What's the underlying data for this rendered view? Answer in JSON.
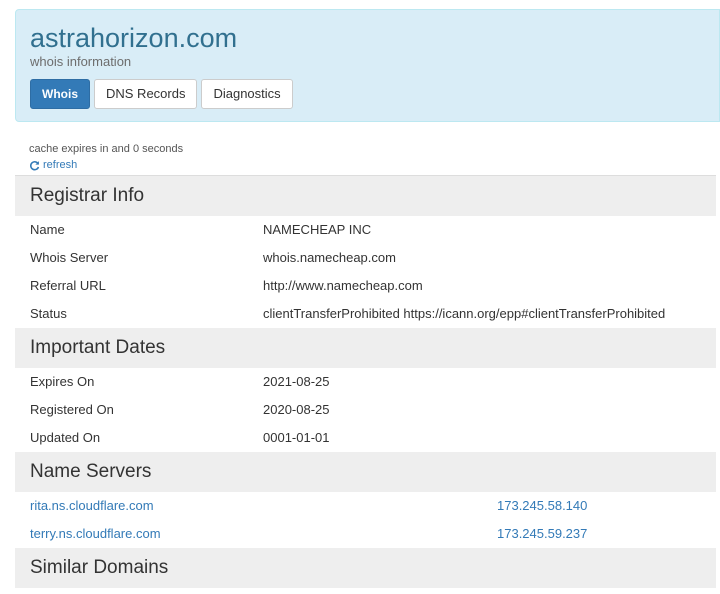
{
  "header": {
    "domain": "astrahorizon.com",
    "subtitle": "whois information",
    "tabs": [
      {
        "label": "Whois",
        "active": true
      },
      {
        "label": "DNS Records",
        "active": false
      },
      {
        "label": "Diagnostics",
        "active": false
      }
    ]
  },
  "cache": {
    "text": "cache expires in and 0 seconds",
    "refresh_label": "refresh",
    "refresh_icon": "refresh-icon"
  },
  "registrar": {
    "title": "Registrar Info",
    "rows": [
      {
        "label": "Name",
        "value": "NAMECHEAP INC"
      },
      {
        "label": "Whois Server",
        "value": "whois.namecheap.com"
      },
      {
        "label": "Referral URL",
        "value": "http://www.namecheap.com"
      },
      {
        "label": "Status",
        "value": "clientTransferProhibited https://icann.org/epp#clientTransferProhibited"
      }
    ]
  },
  "dates": {
    "title": "Important Dates",
    "rows": [
      {
        "label": "Expires On",
        "value": "2021-08-25"
      },
      {
        "label": "Registered On",
        "value": "2020-08-25"
      },
      {
        "label": "Updated On",
        "value": "0001-01-01"
      }
    ]
  },
  "nameservers": {
    "title": "Name Servers",
    "rows": [
      {
        "host": "rita.ns.cloudflare.com",
        "ip": "173.245.58.140"
      },
      {
        "host": "terry.ns.cloudflare.com",
        "ip": "173.245.59.237"
      }
    ]
  },
  "similar": {
    "title": "Similar Domains"
  },
  "colors": {
    "header_bg": "#d9edf7",
    "title_blue": "#31708f",
    "link_blue": "#337ab7",
    "active_tab": "#337ab7",
    "section_bg": "#eeeeee"
  }
}
